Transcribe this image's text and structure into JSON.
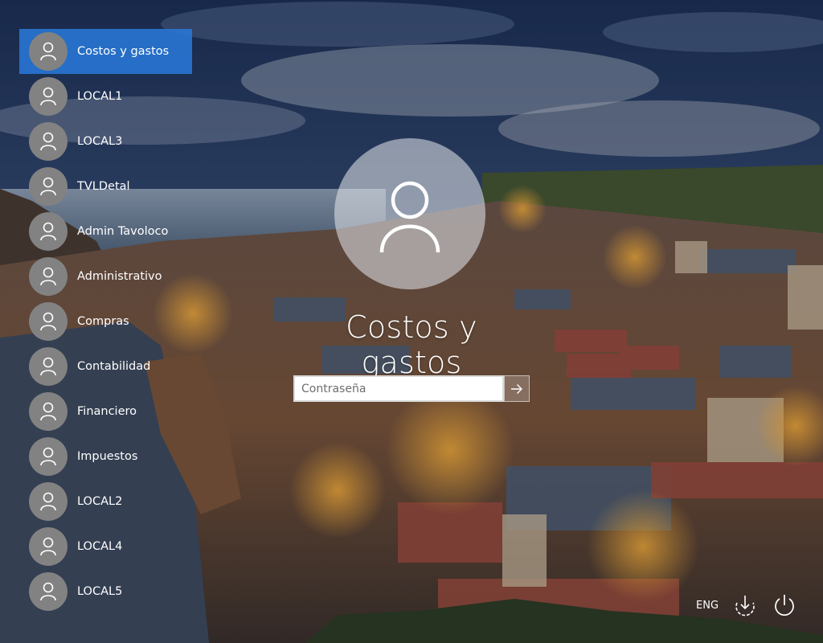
{
  "users": [
    {
      "name": "Costos y gastos",
      "selected": true
    },
    {
      "name": "LOCAL1"
    },
    {
      "name": "LOCAL3"
    },
    {
      "name": "TVLDetal"
    },
    {
      "name": "Admin Tavoloco"
    },
    {
      "name": "Administrativo"
    },
    {
      "name": "Compras"
    },
    {
      "name": "Contabilidad"
    },
    {
      "name": "Financiero"
    },
    {
      "name": "Impuestos"
    },
    {
      "name": "LOCAL2"
    },
    {
      "name": "LOCAL4"
    },
    {
      "name": "LOCAL5"
    }
  ],
  "login": {
    "user_name": "Costos y gastos",
    "password_placeholder": "Contraseña",
    "submit_icon": "arrow-right-icon"
  },
  "system_tray": {
    "language": "ENG",
    "accessibility_icon": "ease-of-access-icon",
    "power_icon": "power-icon"
  },
  "colors": {
    "selected_user_bg": "#2878d7",
    "avatar_bg": "#828282"
  }
}
